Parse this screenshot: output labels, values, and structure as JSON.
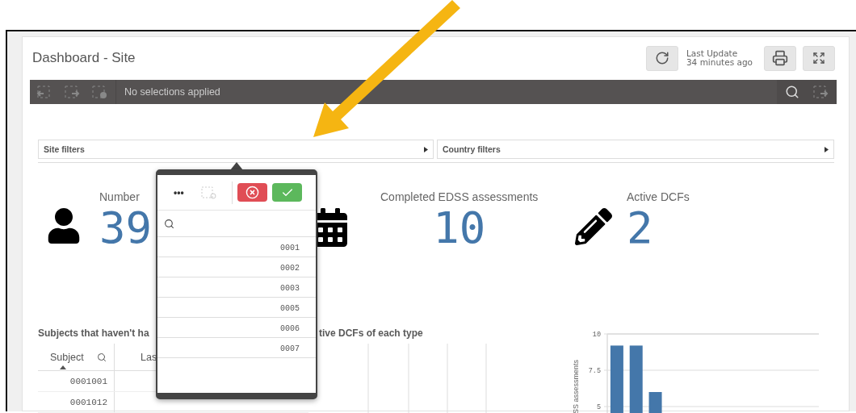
{
  "header": {
    "title": "Dashboard - Site",
    "last_update_label": "Last Update",
    "last_update_time": "34 minutes ago"
  },
  "selection_bar": {
    "status": "No selections applied"
  },
  "filters": [
    {
      "label": "Site filters"
    },
    {
      "label": "Country filters"
    }
  ],
  "kpis": [
    {
      "kind": "person",
      "title": "Number",
      "value": "39"
    },
    {
      "kind": "calendar",
      "title": "Completed EDSS assessments",
      "value": "10"
    },
    {
      "kind": "pencil",
      "title": "Active DCFs",
      "value": "2"
    }
  ],
  "subjects_table": {
    "title": "Subjects that haven't ha",
    "columns": [
      {
        "label": "Subject",
        "sort_ascending": true
      },
      {
        "label": "Las",
        "sort_ascending": false
      }
    ],
    "rows": [
      [
        "0001001"
      ],
      [
        "0001012"
      ]
    ]
  },
  "dcf_chart": {
    "title": "tive DCFs of each type"
  },
  "edss_chart": {
    "chart_data": {
      "type": "bar",
      "ylabel": "SS assessments",
      "values": [
        9.2,
        9.2,
        6,
        null,
        null,
        null,
        null,
        null,
        null,
        null,
        null
      ],
      "ylim": [
        4.5,
        10
      ],
      "yticks": [
        5,
        7.5,
        10
      ]
    }
  },
  "filter_popup": {
    "more_label": "•••",
    "items": [
      "0001",
      "0002",
      "0003",
      "0005",
      "0006",
      "0007"
    ]
  }
}
